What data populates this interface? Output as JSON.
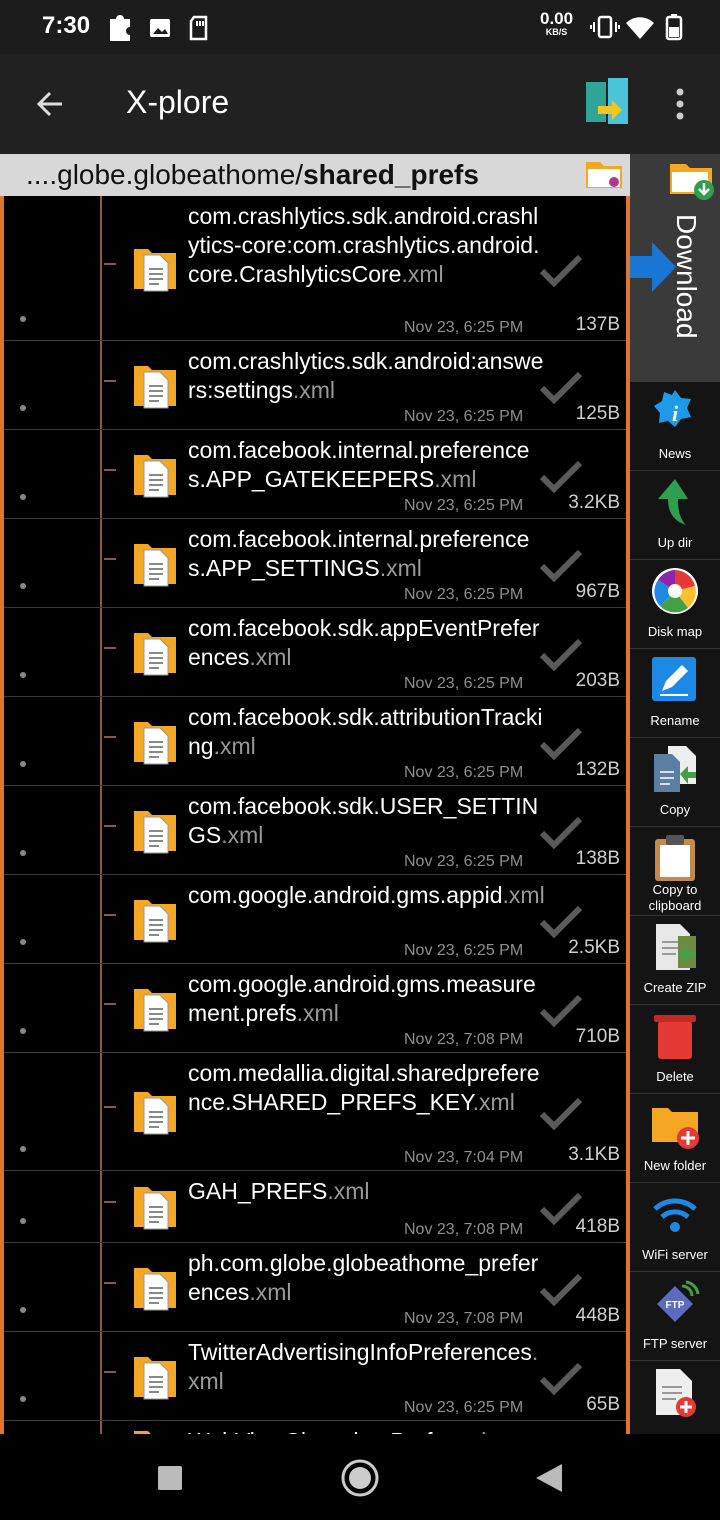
{
  "status_bar": {
    "time": "7:30",
    "speed_value": "0.00",
    "speed_unit": "KB/S"
  },
  "app_bar": {
    "title": "X-plore"
  },
  "path": {
    "prefix": "....globe.globeathome/",
    "current": "shared_prefs"
  },
  "files": [
    {
      "name": "com.crashlytics.sdk.android.crashlytics-core:com.crashlytics.android.core.CrashlyticsCore",
      "ext": ".xml",
      "date": "Nov 23, 6:25 PM",
      "size": "137B"
    },
    {
      "name": "com.crashlytics.sdk.android:answers:settings",
      "ext": ".xml",
      "date": "Nov 23, 6:25 PM",
      "size": "125B"
    },
    {
      "name": "com.facebook.internal.preferences.APP_GATEKEEPERS",
      "ext": ".xml",
      "date": "Nov 23, 6:25 PM",
      "size": "3.2KB"
    },
    {
      "name": "com.facebook.internal.preferences.APP_SETTINGS",
      "ext": ".xml",
      "date": "Nov 23, 6:25 PM",
      "size": "967B"
    },
    {
      "name": "com.facebook.sdk.appEventPreferences",
      "ext": ".xml",
      "date": "Nov 23, 6:25 PM",
      "size": "203B"
    },
    {
      "name": "com.facebook.sdk.attributionTracking",
      "ext": ".xml",
      "date": "Nov 23, 6:25 PM",
      "size": "132B"
    },
    {
      "name": "com.facebook.sdk.USER_SETTINGS",
      "ext": ".xml",
      "date": "Nov 23, 6:25 PM",
      "size": "138B"
    },
    {
      "name": "com.google.android.gms.appid",
      "ext": ".xml",
      "date": "Nov 23, 6:25 PM",
      "size": "2.5KB"
    },
    {
      "name": "com.google.android.gms.measurement.prefs",
      "ext": ".xml",
      "date": "Nov 23, 7:08 PM",
      "size": "710B"
    },
    {
      "name": "com.medallia.digital.sharedpreference.SHARED_PREFS_KEY",
      "ext": ".xml",
      "date": "Nov 23, 7:04 PM",
      "size": "3.1KB"
    },
    {
      "name": "GAH_PREFS",
      "ext": ".xml",
      "date": "Nov 23, 7:08 PM",
      "size": "418B"
    },
    {
      "name": "ph.com.globe.globeathome_preferences",
      "ext": ".xml",
      "date": "Nov 23, 7:08 PM",
      "size": "448B"
    },
    {
      "name": "TwitterAdvertisingInfoPreferences",
      "ext": ".xml",
      "date": "Nov 23, 6:25 PM",
      "size": "65B"
    },
    {
      "name": "WebViewChromiumPrefs",
      "ext": ".xml",
      "date": "",
      "size": ""
    }
  ],
  "sidebar": {
    "download_label": "Download",
    "tools": [
      {
        "label": "News",
        "icon": "news-icon"
      },
      {
        "label": "Up dir",
        "icon": "up-dir-icon"
      },
      {
        "label": "Disk map",
        "icon": "disk-map-icon"
      },
      {
        "label": "Rename",
        "icon": "rename-icon"
      },
      {
        "label": "Copy",
        "icon": "copy-icon"
      },
      {
        "label": "Copy to clipboard",
        "icon": "clipboard-icon"
      },
      {
        "label": "Create ZIP",
        "icon": "zip-icon"
      },
      {
        "label": "Delete",
        "icon": "delete-icon"
      },
      {
        "label": "New folder",
        "icon": "new-folder-icon"
      },
      {
        "label": "WiFi server",
        "icon": "wifi-server-icon"
      },
      {
        "label": "FTP server",
        "icon": "ftp-server-icon"
      },
      {
        "label": "",
        "icon": "new-file-icon"
      }
    ]
  },
  "colors": {
    "accent": "#e0752d",
    "folder": "#f5a623",
    "status_bar": "#1c1c1c",
    "app_bar": "#212121"
  }
}
